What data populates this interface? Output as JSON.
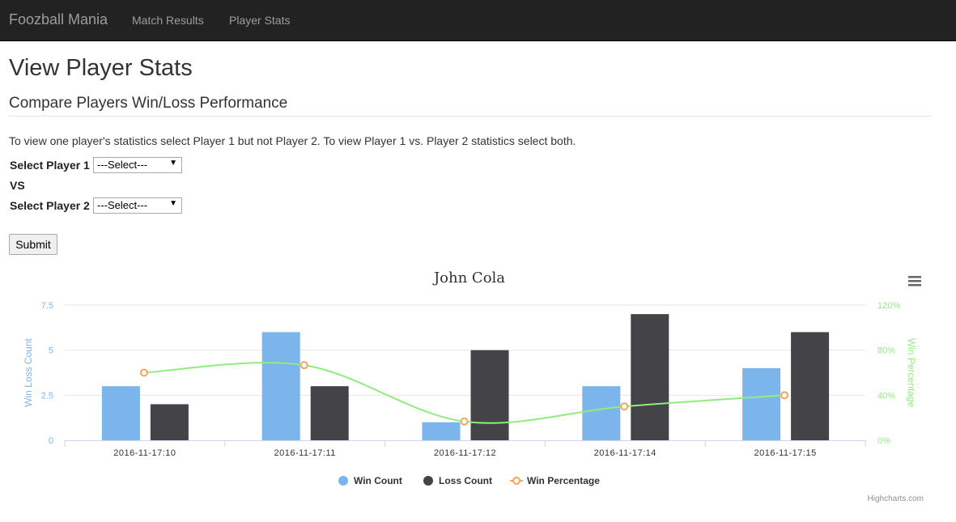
{
  "navbar": {
    "brand": "Foozball Mania",
    "links": [
      "Match Results",
      "Player Stats"
    ]
  },
  "page": {
    "title": "View Player Stats",
    "subtitle": "Compare Players Win/Loss Performance",
    "help_text": "To view one player's statistics select Player 1 but not Player 2. To view Player 1 vs. Player 2 statistics select both."
  },
  "form": {
    "player1_label": "Select Player 1",
    "player1_value": "---Select---",
    "vs_label": "VS",
    "player2_label": "Select Player 2",
    "player2_value": "---Select---",
    "submit_label": "Submit"
  },
  "chart_data": {
    "type": "bar",
    "title": "John Cola",
    "categories": [
      "2016-11-17:10",
      "2016-11-17:11",
      "2016-11-17:12",
      "2016-11-17:14",
      "2016-11-17:15"
    ],
    "series": [
      {
        "name": "Win Count",
        "type": "bar",
        "color": "#7cb5ec",
        "values": [
          3,
          6,
          1,
          3,
          4
        ]
      },
      {
        "name": "Loss Count",
        "type": "bar",
        "color": "#434348",
        "values": [
          2,
          3,
          5,
          7,
          6
        ]
      },
      {
        "name": "Win Percentage",
        "type": "spline",
        "color": "#90ed7d",
        "marker_color": "#f7a35c",
        "values": [
          60,
          66.7,
          16.7,
          30,
          40
        ]
      }
    ],
    "y_left": {
      "label": "Win Loss Count",
      "ticks": [
        "0",
        "2.5",
        "5",
        "7.5"
      ],
      "ylim": [
        0,
        7.5
      ],
      "color": "#7cb5ec"
    },
    "y_right": {
      "label": "Win Percentage",
      "ticks": [
        "0%",
        "40%",
        "80%",
        "120%"
      ],
      "ylim": [
        0,
        120
      ],
      "color": "#90ed7d"
    },
    "grid": true,
    "legend_position": "bottom-center",
    "credits": "Highcharts.com",
    "menu_icon": "hamburger-menu-icon"
  }
}
